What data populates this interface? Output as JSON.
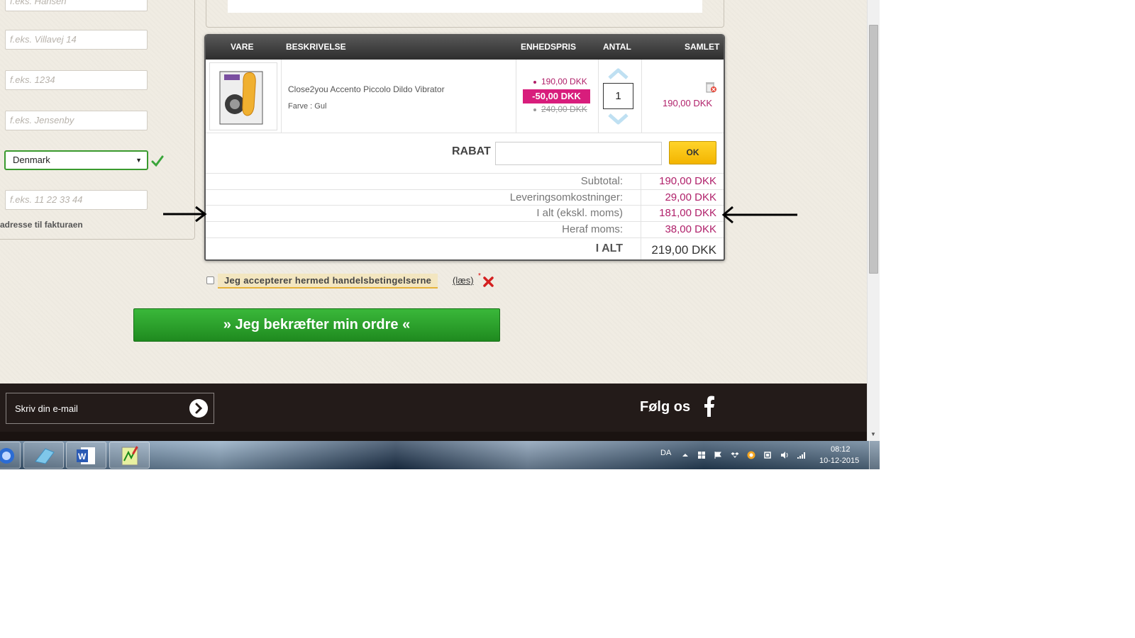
{
  "form": {
    "placeholders": [
      "f.eks. Hansen",
      "f.eks. Villavej 14",
      "f.eks. 1234",
      "f.eks. Jensenby",
      "f.eks. 11 22 33 44"
    ],
    "country_selected": "Denmark",
    "billing_text": "adresse til fakturaen"
  },
  "cart": {
    "headers": {
      "item": "VARE",
      "description": "BESKRIVELSE",
      "unit_price": "ENHEDSPRIS",
      "quantity": "ANTAL",
      "total": "SAMLET"
    },
    "product": {
      "name": "Close2you Accento Piccolo Dildo Vibrator",
      "color": "Farve : Gul",
      "price_current": "190,00 DKK",
      "discount": "-50,00 DKK",
      "price_original": "240,00 DKK",
      "quantity": "1",
      "line_total": "190,00 DKK"
    },
    "discount_label": "RABAT",
    "ok_label": "OK",
    "summary": {
      "subtotal_label": "Subtotal:",
      "subtotal_value": "190,00 DKK",
      "shipping_label": "Leveringsomkostninger:",
      "shipping_value": "29,00 DKK",
      "excl_vat_label": "I alt (ekskl. moms)",
      "excl_vat_value": "181,00 DKK",
      "vat_label": "Heraf moms:",
      "vat_value": "38,00 DKK",
      "total_label": "I ALT",
      "total_value": "219,00 DKK"
    }
  },
  "terms": {
    "label": "Jeg accepterer hermed handelsbetingelserne",
    "link": "(læs)",
    "required_mark": "*"
  },
  "confirm_button": "» Jeg bekræfter min ordre «",
  "footer": {
    "email_placeholder": "Skriv din e-mail",
    "follow_label": "Følg os"
  },
  "taskbar": {
    "language": "DA",
    "time": "08:12",
    "date": "10-12-2015"
  },
  "colors": {
    "price_accent": "#b0206a",
    "discount_badge": "#d81d7c",
    "confirm_green": "#2a9d2a",
    "ok_yellow": "#f9c515",
    "footer_dark": "#231b19"
  },
  "icons": [
    "checkmark-icon",
    "trash-icon",
    "chevron-up-icon",
    "chevron-down-icon",
    "red-x-icon",
    "arrow-right-circle-icon",
    "facebook-icon",
    "arrow-right-icon",
    "arrow-left-icon",
    "windows-flag-icon",
    "dropbox-icon",
    "volume-icon",
    "signal-icon"
  ]
}
